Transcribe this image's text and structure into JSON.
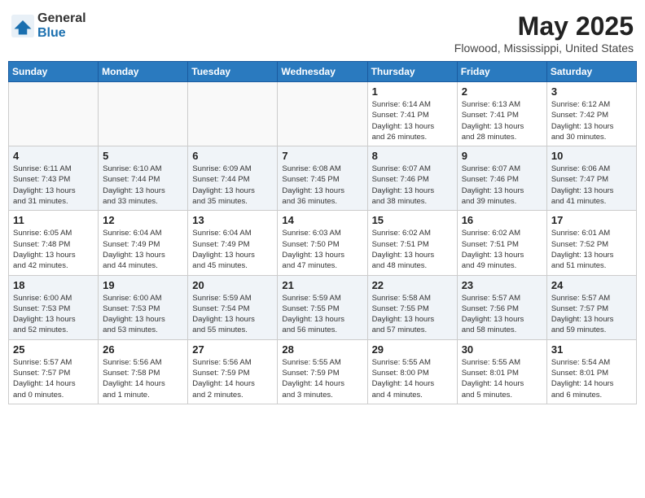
{
  "logo": {
    "general": "General",
    "blue": "Blue"
  },
  "header": {
    "month": "May 2025",
    "location": "Flowood, Mississippi, United States"
  },
  "weekdays": [
    "Sunday",
    "Monday",
    "Tuesday",
    "Wednesday",
    "Thursday",
    "Friday",
    "Saturday"
  ],
  "weeks": [
    [
      {
        "day": "",
        "info": ""
      },
      {
        "day": "",
        "info": ""
      },
      {
        "day": "",
        "info": ""
      },
      {
        "day": "",
        "info": ""
      },
      {
        "day": "1",
        "info": "Sunrise: 6:14 AM\nSunset: 7:41 PM\nDaylight: 13 hours\nand 26 minutes."
      },
      {
        "day": "2",
        "info": "Sunrise: 6:13 AM\nSunset: 7:41 PM\nDaylight: 13 hours\nand 28 minutes."
      },
      {
        "day": "3",
        "info": "Sunrise: 6:12 AM\nSunset: 7:42 PM\nDaylight: 13 hours\nand 30 minutes."
      }
    ],
    [
      {
        "day": "4",
        "info": "Sunrise: 6:11 AM\nSunset: 7:43 PM\nDaylight: 13 hours\nand 31 minutes."
      },
      {
        "day": "5",
        "info": "Sunrise: 6:10 AM\nSunset: 7:44 PM\nDaylight: 13 hours\nand 33 minutes."
      },
      {
        "day": "6",
        "info": "Sunrise: 6:09 AM\nSunset: 7:44 PM\nDaylight: 13 hours\nand 35 minutes."
      },
      {
        "day": "7",
        "info": "Sunrise: 6:08 AM\nSunset: 7:45 PM\nDaylight: 13 hours\nand 36 minutes."
      },
      {
        "day": "8",
        "info": "Sunrise: 6:07 AM\nSunset: 7:46 PM\nDaylight: 13 hours\nand 38 minutes."
      },
      {
        "day": "9",
        "info": "Sunrise: 6:07 AM\nSunset: 7:46 PM\nDaylight: 13 hours\nand 39 minutes."
      },
      {
        "day": "10",
        "info": "Sunrise: 6:06 AM\nSunset: 7:47 PM\nDaylight: 13 hours\nand 41 minutes."
      }
    ],
    [
      {
        "day": "11",
        "info": "Sunrise: 6:05 AM\nSunset: 7:48 PM\nDaylight: 13 hours\nand 42 minutes."
      },
      {
        "day": "12",
        "info": "Sunrise: 6:04 AM\nSunset: 7:49 PM\nDaylight: 13 hours\nand 44 minutes."
      },
      {
        "day": "13",
        "info": "Sunrise: 6:04 AM\nSunset: 7:49 PM\nDaylight: 13 hours\nand 45 minutes."
      },
      {
        "day": "14",
        "info": "Sunrise: 6:03 AM\nSunset: 7:50 PM\nDaylight: 13 hours\nand 47 minutes."
      },
      {
        "day": "15",
        "info": "Sunrise: 6:02 AM\nSunset: 7:51 PM\nDaylight: 13 hours\nand 48 minutes."
      },
      {
        "day": "16",
        "info": "Sunrise: 6:02 AM\nSunset: 7:51 PM\nDaylight: 13 hours\nand 49 minutes."
      },
      {
        "day": "17",
        "info": "Sunrise: 6:01 AM\nSunset: 7:52 PM\nDaylight: 13 hours\nand 51 minutes."
      }
    ],
    [
      {
        "day": "18",
        "info": "Sunrise: 6:00 AM\nSunset: 7:53 PM\nDaylight: 13 hours\nand 52 minutes."
      },
      {
        "day": "19",
        "info": "Sunrise: 6:00 AM\nSunset: 7:53 PM\nDaylight: 13 hours\nand 53 minutes."
      },
      {
        "day": "20",
        "info": "Sunrise: 5:59 AM\nSunset: 7:54 PM\nDaylight: 13 hours\nand 55 minutes."
      },
      {
        "day": "21",
        "info": "Sunrise: 5:59 AM\nSunset: 7:55 PM\nDaylight: 13 hours\nand 56 minutes."
      },
      {
        "day": "22",
        "info": "Sunrise: 5:58 AM\nSunset: 7:55 PM\nDaylight: 13 hours\nand 57 minutes."
      },
      {
        "day": "23",
        "info": "Sunrise: 5:57 AM\nSunset: 7:56 PM\nDaylight: 13 hours\nand 58 minutes."
      },
      {
        "day": "24",
        "info": "Sunrise: 5:57 AM\nSunset: 7:57 PM\nDaylight: 13 hours\nand 59 minutes."
      }
    ],
    [
      {
        "day": "25",
        "info": "Sunrise: 5:57 AM\nSunset: 7:57 PM\nDaylight: 14 hours\nand 0 minutes."
      },
      {
        "day": "26",
        "info": "Sunrise: 5:56 AM\nSunset: 7:58 PM\nDaylight: 14 hours\nand 1 minute."
      },
      {
        "day": "27",
        "info": "Sunrise: 5:56 AM\nSunset: 7:59 PM\nDaylight: 14 hours\nand 2 minutes."
      },
      {
        "day": "28",
        "info": "Sunrise: 5:55 AM\nSunset: 7:59 PM\nDaylight: 14 hours\nand 3 minutes."
      },
      {
        "day": "29",
        "info": "Sunrise: 5:55 AM\nSunset: 8:00 PM\nDaylight: 14 hours\nand 4 minutes."
      },
      {
        "day": "30",
        "info": "Sunrise: 5:55 AM\nSunset: 8:01 PM\nDaylight: 14 hours\nand 5 minutes."
      },
      {
        "day": "31",
        "info": "Sunrise: 5:54 AM\nSunset: 8:01 PM\nDaylight: 14 hours\nand 6 minutes."
      }
    ]
  ]
}
